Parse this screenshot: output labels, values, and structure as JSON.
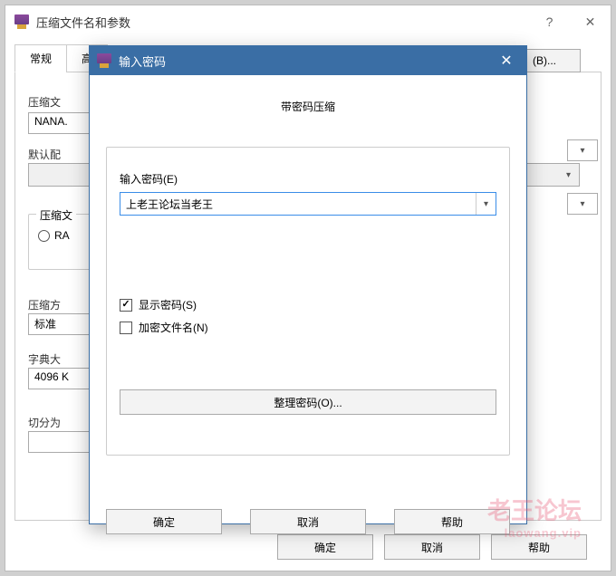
{
  "main": {
    "title": "压缩文件名和参数",
    "tabs": {
      "general": "常规",
      "advanced_partial": "高"
    },
    "archive_name_label": "压缩文",
    "archive_name_value": "NANA.",
    "browse_button": "(B)...",
    "default_config_label": "默认配",
    "format_group_label": "压缩文",
    "format_ra_partial": "RA",
    "method_label": "压缩方",
    "method_value": "标准",
    "dict_label": "字典大",
    "dict_value": "4096 K",
    "split_label": "切分为",
    "ok": "确定",
    "cancel": "取消",
    "help": "帮助"
  },
  "pwd": {
    "title": "输入密码",
    "subtitle": "带密码压缩",
    "enter_label": "输入密码(E)",
    "value": "上老王论坛当老王",
    "show_password": "显示密码(S)",
    "encrypt_names": "加密文件名(N)",
    "organize": "整理密码(O)...",
    "ok": "确定",
    "cancel": "取消",
    "help": "帮助"
  },
  "watermark": {
    "line1": "老王论坛",
    "line2": "laowang.vip"
  }
}
